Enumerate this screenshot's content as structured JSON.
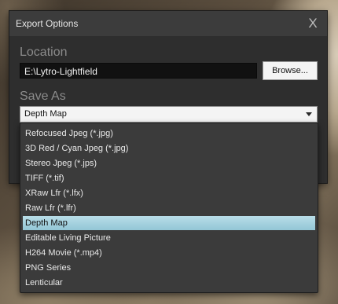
{
  "dialog": {
    "title": "Export Options",
    "close_glyph": "X",
    "location": {
      "label": "Location",
      "path_value": "E:\\Lytro-Lightfield",
      "browse_label": "Browse..."
    },
    "save_as": {
      "label": "Save As",
      "selected_value": "Depth Map",
      "options": [
        "Refocused Jpeg (*.jpg)",
        "3D Red / Cyan Jpeg (*.jpg)",
        "Stereo Jpeg (*.jps)",
        "TIFF (*.tif)",
        "XRaw Lfr (*.lfx)",
        "Raw Lfr (*.lfr)",
        "Depth Map",
        "Editable Living Picture",
        "H264 Movie (*.mp4)",
        "PNG Series",
        "Lenticular"
      ]
    }
  },
  "colors": {
    "selection_highlight": "#a6d2e0",
    "dialog_bg": "#2e2e2e",
    "titlebar_bg": "#3c3c3c"
  },
  "icons": {
    "close": "close-icon",
    "dropdown": "chevron-down-icon"
  }
}
